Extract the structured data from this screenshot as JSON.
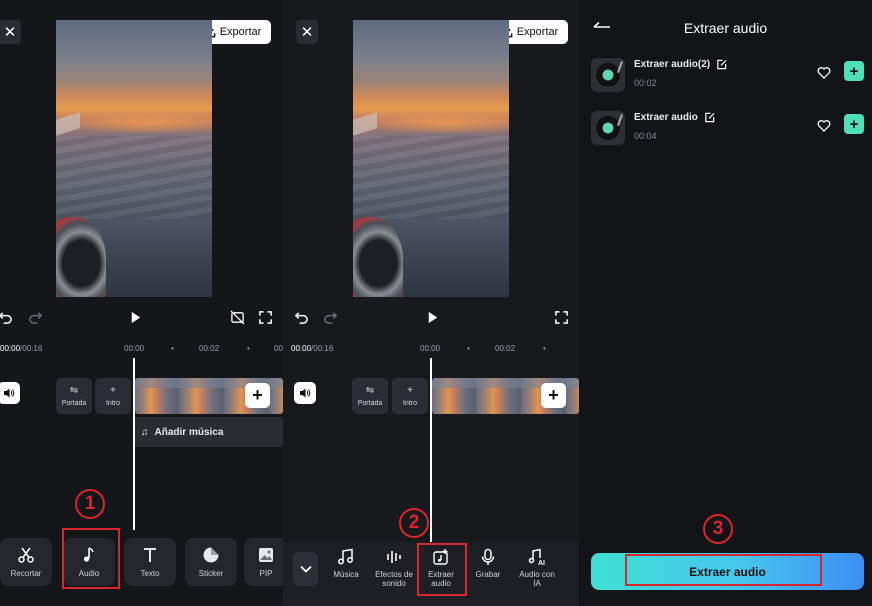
{
  "panel1": {
    "export_label": "Exportar",
    "time_current": "00:00",
    "time_total": "00:16",
    "ruler_marks": [
      "00:00",
      "•",
      "00:02",
      "•",
      "00"
    ],
    "cover_label": "Portada",
    "intro_label": "Intro",
    "add_music_label": "Añadir música",
    "tools": [
      {
        "label": "Recortar",
        "icon": "scissors-icon"
      },
      {
        "label": "Audio",
        "icon": "music-note-icon"
      },
      {
        "label": "Texto",
        "icon": "text-icon"
      },
      {
        "label": "Sticker",
        "icon": "sticker-icon"
      },
      {
        "label": "PIP",
        "icon": "image-icon"
      }
    ],
    "step": "1"
  },
  "panel2": {
    "export_label": "Exportar",
    "time_current": "00:00",
    "time_total": "00:16",
    "ruler_marks": [
      "00:00",
      "•",
      "00:02",
      "•"
    ],
    "cover_label": "Portada",
    "intro_label": "Intro",
    "tools": [
      {
        "label": "Música",
        "icon": "music-icon"
      },
      {
        "label": "Efectos de sonido",
        "icon": "waveform-icon"
      },
      {
        "label": "Extraer audio",
        "icon": "extract-audio-icon"
      },
      {
        "label": "Grabar",
        "icon": "microphone-icon"
      },
      {
        "label": "Audio con IA",
        "icon": "ai-audio-icon"
      }
    ],
    "step": "2"
  },
  "panel3": {
    "title": "Extraer audio",
    "items": [
      {
        "name": "Extraer audio(2)",
        "duration": "00:02"
      },
      {
        "name": "Extraer audio",
        "duration": "00:04"
      }
    ],
    "extract_button": "Extraer audio",
    "step": "3"
  },
  "colors": {
    "accent_green": "#4fe0b5",
    "highlight_red": "#d9252c",
    "button_gradient_start": "#3ee0d3",
    "button_gradient_end": "#3d8ef2"
  }
}
